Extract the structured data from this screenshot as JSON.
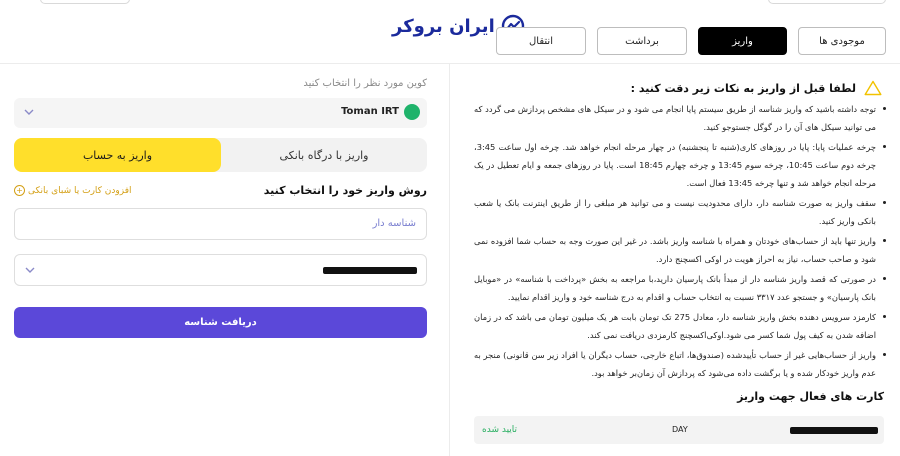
{
  "header": {
    "logo_text": "ایران بروکر",
    "tabs": [
      {
        "label": "موجودی ها",
        "active": false
      },
      {
        "label": "واریز",
        "active": true
      },
      {
        "label": "برداشت",
        "active": false
      },
      {
        "label": "انتقال",
        "active": false
      }
    ]
  },
  "deposit_form": {
    "coin_label": "کوین مورد نظر را انتخاب کنید",
    "selected_coin": "Toman IRT",
    "method_bank_gateway": "واریز با درگاه بانکی",
    "method_to_account": "واریز به حساب",
    "select_method_title": "روش واریز خود را انتخاب کنید",
    "add_card": "افزودن کارت یا شبای بانکی",
    "id_type": "شناسه دار",
    "submit": "دریافت شناسه"
  },
  "notes": {
    "title": "لطفا قبل از واریز به نکات زیر دقت کنید :",
    "items": [
      "توجه داشته باشید که واریز شناسه از طریق سیستم پایا انجام می شود و در سیکل های مشخص پردازش می گردد که می توانید سیکل های آن را در گوگل جستوجو کنید.",
      "چرخه عملیات پایا: پایا در روزهای کاری(شنبه تا پنجشنبه) در چهار مرحله انجام خواهد شد. چرخه اول ساعت 3:45، چرخه دوم ساعت 10:45، چرخه سوم 13:45 و چرخه چهارم 18:45 است. پایا در روزهای جمعه و ایام تعطیل در یک مرحله انجام خواهد شد و تنها چرخه 13:45 فعال است.",
      "سقف واریز به صورت شناسه دار، دارای محدودیت نیست و می توانید هر مبلغی را از طریق اینترنت بانک یا شعب بانکی واریز کنید.",
      "واریز تنها باید از حساب‌های خودتان و همراه با شناسه واریز باشد. در غیر این صورت وجه به حساب شما افزوده نمی شود و صاحب حساب، نیاز به احراز هویت در اوکی اکسچنج دارد.",
      "در صورتی که قصد واریز شناسه دار از مبدأ بانک پارسیان دارید،با مراجعه به بخش «پرداخت با شناسه» در «موبایل بانک پارسیان» و جستجو عدد ۳۳۱۷ نسبت به انتخاب حساب و اقدام به درج شناسه خود و واریز اقدام نمایید.",
      "کارمزد سرویس دهنده بخش واریز شناسه دار، معادل 275 تک تومان بابت هر یک میلیون تومان می باشد که در زمان اضافه شدن به کیف پول شما کسر می شود.اوکی‌اکسچنج کارمزدی دریافت نمی کند.",
      "واریز از حساب‌هایی غیر از حساب تأییدشده (صندوق‌ها، اتباع خارجی، حساب دیگران یا افراد زیر سن قانونی) منجر به عدم واریز خودکار شده و یا برگشت داده می‌شود که پردازش آن زمان‌بر خواهد بود."
    ]
  },
  "active_cards": {
    "title": "کارت های فعال جهت واریز",
    "rows": [
      {
        "bank": "DAY",
        "status": "تایید شده"
      }
    ]
  },
  "colors": {
    "accent_yellow": "#ffdf2b",
    "primary_purple": "#5b48d9",
    "logo_blue": "#1b2a9c",
    "success_green": "#27ae60",
    "coin_green": "#1fb36b"
  }
}
